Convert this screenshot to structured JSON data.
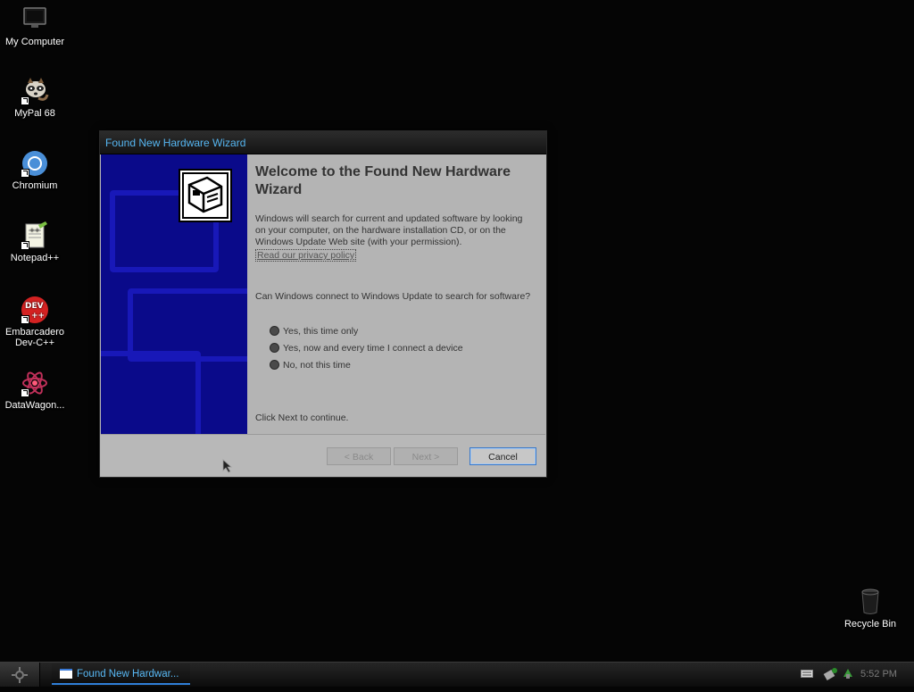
{
  "desktop": {
    "icons": [
      {
        "label": "My Computer"
      },
      {
        "label": "MyPal 68"
      },
      {
        "label": "Chromium"
      },
      {
        "label": "Notepad++"
      },
      {
        "label": "Embarcadero Dev-C++"
      },
      {
        "label": "DataWagon..."
      },
      {
        "label": "Recycle Bin"
      }
    ]
  },
  "wizard": {
    "title": "Found New Hardware Wizard",
    "heading": "Welcome to the Found New Hardware Wizard",
    "intro": "Windows will search for current and updated software by looking on your computer, on the hardware installation CD, or on the Windows Update Web site (with your permission).",
    "privacy_link": "Read our privacy policy",
    "question": "Can Windows connect to Windows Update to search for software?",
    "options": [
      {
        "label": "Yes, this time only"
      },
      {
        "label": "Yes, now and every time I connect a device"
      },
      {
        "label": "No, not this time"
      }
    ],
    "continue_text": "Click Next to continue.",
    "buttons": {
      "back": "< Back",
      "next": "Next >",
      "cancel": "Cancel"
    }
  },
  "taskbar": {
    "task_label": "Found New Hardwar...",
    "clock": "5:52 PM"
  },
  "colors": {
    "desktop_bg": "#050505",
    "title_text": "#55b5f0",
    "side_panel": "#0a0a8a",
    "focus_border": "#3a78c8"
  }
}
